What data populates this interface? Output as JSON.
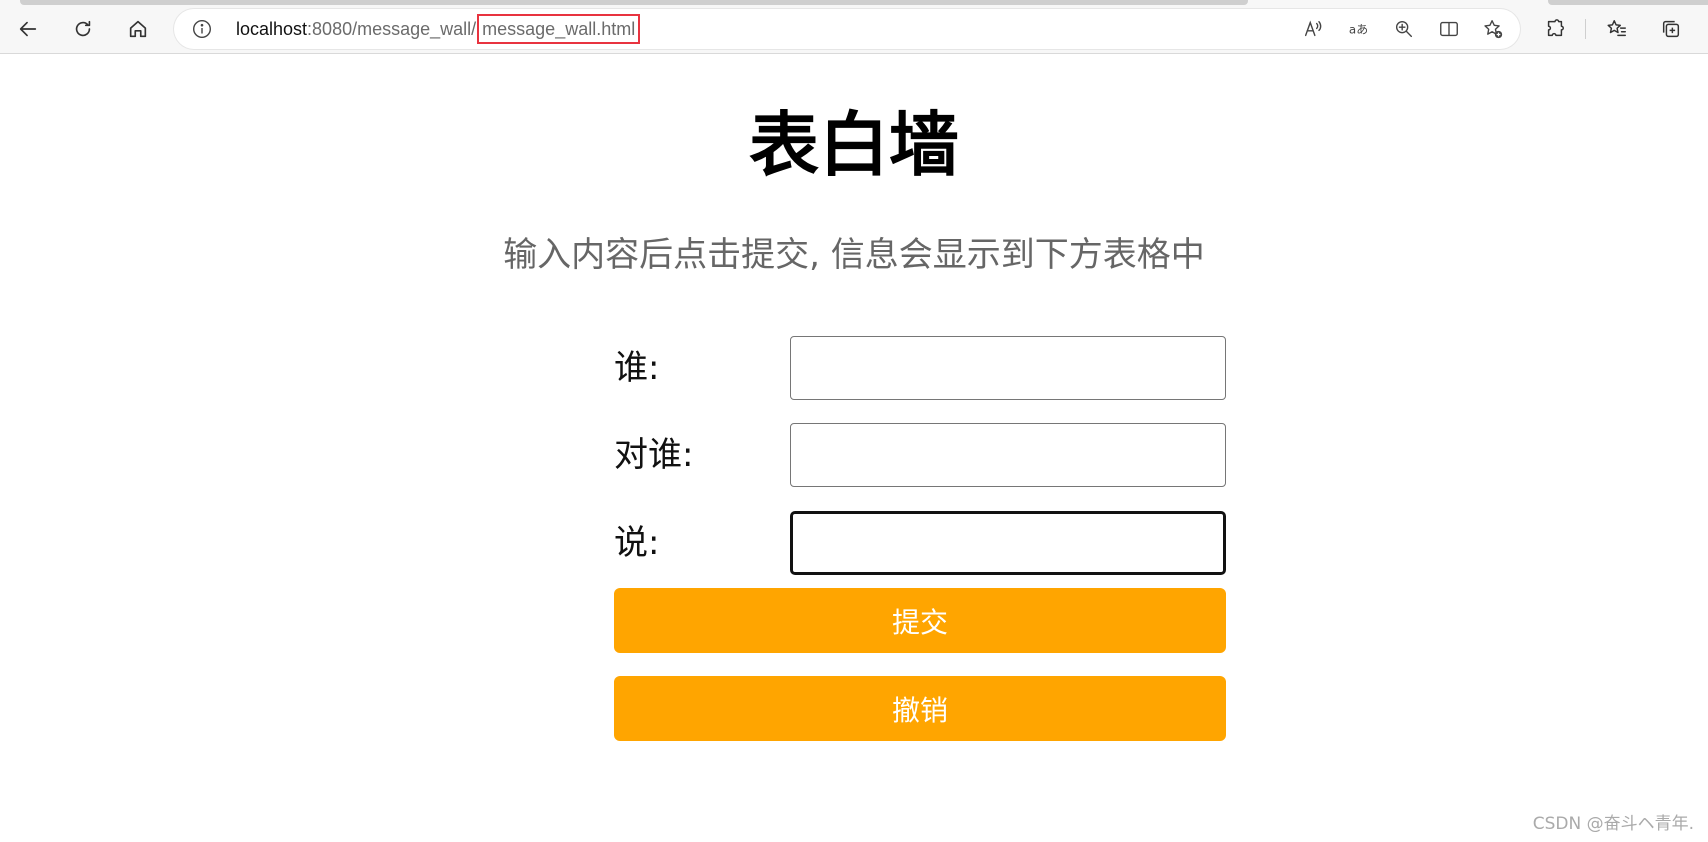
{
  "browser": {
    "url_host": "localhost",
    "url_path": ":8080/message_wall/",
    "url_file": "message_wall.html"
  },
  "page": {
    "title": "表白墙",
    "subtitle": "输入内容后点击提交, 信息会显示到下方表格中"
  },
  "form": {
    "fields": [
      {
        "label": "谁:",
        "value": ""
      },
      {
        "label": "对谁:",
        "value": ""
      },
      {
        "label": "说:",
        "value": ""
      }
    ],
    "submit_label": "提交",
    "revoke_label": "撤销",
    "button_color": "#ffa500"
  },
  "watermark": "CSDN @奋斗ヘ青年."
}
